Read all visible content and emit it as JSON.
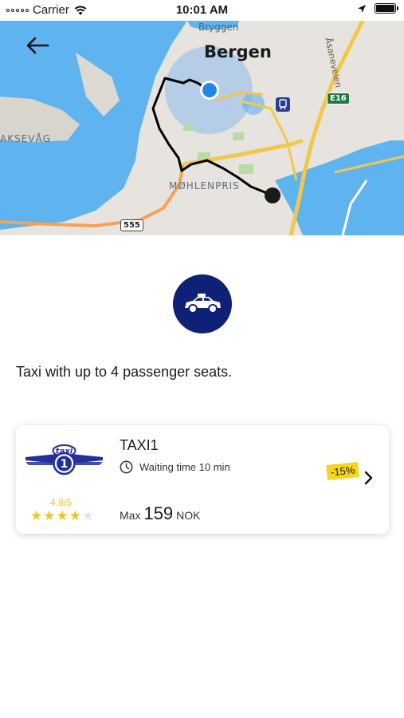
{
  "status_bar": {
    "carrier": "Carrier",
    "time": "10:01 AM",
    "icons": [
      "signal-dots-icon",
      "wifi-icon",
      "location-arrow-icon",
      "battery-icon"
    ]
  },
  "map": {
    "labels": {
      "city": "Bergen",
      "bryggen": "Bryggen",
      "mohlenpris": "MØHLENPRIS",
      "laksevag": "AKSEVÅG",
      "asaneveien": "Åsaneveien"
    },
    "road_shields": {
      "e16": "E16",
      "r555": "555"
    },
    "colors": {
      "water": "#5fb3ee",
      "land": "#e7e4df",
      "road_major": "#f2c84b",
      "road_orange": "#f4a259",
      "route": "#000000",
      "user_location": "#1e88e5"
    }
  },
  "vehicle_type": {
    "icon": "taxi-car-icon",
    "color": "#0f2077"
  },
  "description": "Taxi with up to 4 passenger seats.",
  "offer": {
    "company_name": "TAXI1",
    "logo_text": "taxi",
    "logo_number": "1",
    "rating": "4.8/5",
    "stars_filled": 4,
    "stars_total": 5,
    "waiting_time": "Waiting time 10 min",
    "price_prefix": "Max",
    "price_amount": "159",
    "currency": "NOK",
    "discount": "-15%",
    "colors": {
      "discount_bg": "#f7d51d",
      "star": "#f0c419"
    }
  }
}
